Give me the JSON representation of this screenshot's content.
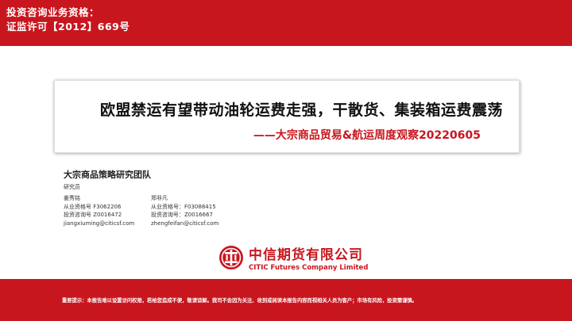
{
  "header": {
    "line1": "投资咨询业务资格：",
    "line2": "证监许可【2012】669号"
  },
  "title": {
    "main": "欧盟禁运有望带动油轮运费走强，干散货、集装箱运费震荡",
    "sub": "——大宗商品贸易&航运周度观察20220605"
  },
  "team": {
    "name": "大宗商品策略研究团队",
    "role": "研究员",
    "researchers": [
      {
        "name": "姜秀铭",
        "license": "从业资格号 F3062206",
        "advisory": "投资咨询号 Z0016472",
        "email": "jiangxiuming@citicsf.com"
      },
      {
        "name": "郑非凡",
        "license": "从业资格号：F03088415",
        "advisory": "投资咨询号：Z0016667",
        "email": "zhengfeifan@citicsf.com"
      }
    ]
  },
  "logo": {
    "cn": "中信期货有限公司",
    "en": "CITIC Futures Company Limited",
    "icon": "citic-logo-icon"
  },
  "footer": {
    "notice": "重要提示：本报告难以设置访问权限，若给您造成不便，敬请谅解。我司不会因为关注、收到或阅读本报告内容而视相关人员为客户；市场有风险，投资需谨慎。"
  },
  "colors": {
    "brand_red": "#c8161e",
    "text_dark": "#111111",
    "background": "#ffffff"
  }
}
